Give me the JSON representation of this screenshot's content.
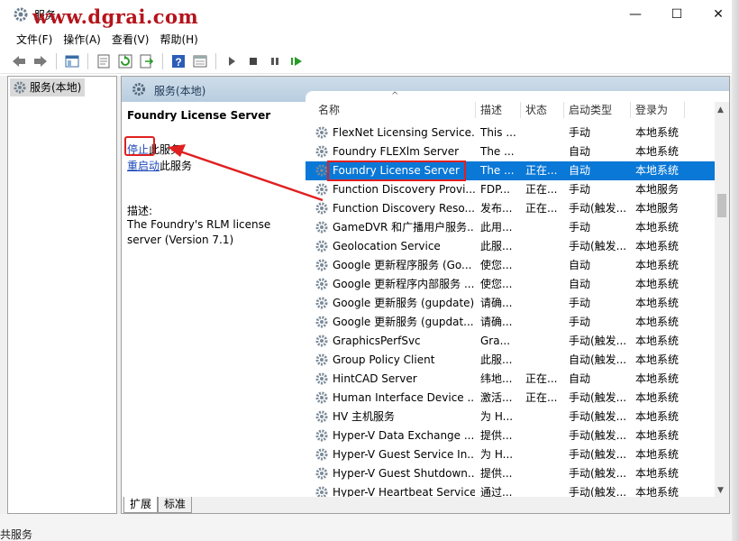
{
  "window": {
    "title": "服务",
    "watermark": "www.dgrai.com",
    "minimize_glyph": "—",
    "maximize_glyph": "☐",
    "close_glyph": "✕"
  },
  "menu": [
    "文件(F)",
    "操作(A)",
    "查看(V)",
    "帮助(H)"
  ],
  "tree": {
    "root": "服务(本地)"
  },
  "pane": {
    "header": "服务(本地)"
  },
  "detail": {
    "service_name": "Foundry License Server",
    "stop_link": "停止",
    "stop_suffix": "此服务",
    "restart_link": "重启动",
    "restart_suffix": "此服务",
    "desc_label": "描述:",
    "desc_text": "The Foundry's RLM license server (Version 7.1)"
  },
  "columns": [
    "名称",
    "描述",
    "状态",
    "启动类型",
    "登录为"
  ],
  "services": [
    {
      "name": "FlexNet Licensing Service...",
      "desc": "This ...",
      "status": "",
      "type": "手动",
      "logon": "本地系统"
    },
    {
      "name": "Foundry FLEXlm Server",
      "desc": "The ...",
      "status": "",
      "type": "自动",
      "logon": "本地系统"
    },
    {
      "name": "Foundry License Server",
      "desc": "The ...",
      "status": "正在...",
      "type": "自动",
      "logon": "本地系统"
    },
    {
      "name": "Function Discovery Provi...",
      "desc": "FDP...",
      "status": "正在...",
      "type": "手动",
      "logon": "本地服务"
    },
    {
      "name": "Function Discovery Reso...",
      "desc": "发布...",
      "status": "正在...",
      "type": "手动(触发...",
      "logon": "本地服务"
    },
    {
      "name": "GameDVR 和广播用户服务...",
      "desc": "此用...",
      "status": "",
      "type": "手动",
      "logon": "本地系统"
    },
    {
      "name": "Geolocation Service",
      "desc": "此服...",
      "status": "",
      "type": "手动(触发...",
      "logon": "本地系统"
    },
    {
      "name": "Google 更新程序服务 (Go...",
      "desc": "使您...",
      "status": "",
      "type": "自动",
      "logon": "本地系统"
    },
    {
      "name": "Google 更新程序内部服务 ...",
      "desc": "使您...",
      "status": "",
      "type": "自动",
      "logon": "本地系统"
    },
    {
      "name": "Google 更新服务 (gupdate)",
      "desc": "请确...",
      "status": "",
      "type": "手动",
      "logon": "本地系统"
    },
    {
      "name": "Google 更新服务 (gupdat...",
      "desc": "请确...",
      "status": "",
      "type": "手动",
      "logon": "本地系统"
    },
    {
      "name": "GraphicsPerfSvc",
      "desc": "Gra...",
      "status": "",
      "type": "手动(触发...",
      "logon": "本地系统"
    },
    {
      "name": "Group Policy Client",
      "desc": "此服...",
      "status": "",
      "type": "自动(触发...",
      "logon": "本地系统"
    },
    {
      "name": "HintCAD Server",
      "desc": "纬地...",
      "status": "正在...",
      "type": "自动",
      "logon": "本地系统"
    },
    {
      "name": "Human Interface Device ...",
      "desc": "激活...",
      "status": "正在...",
      "type": "手动(触发...",
      "logon": "本地系统"
    },
    {
      "name": "HV 主机服务",
      "desc": "为 H...",
      "status": "",
      "type": "手动(触发...",
      "logon": "本地系统"
    },
    {
      "name": "Hyper-V Data Exchange ...",
      "desc": "提供...",
      "status": "",
      "type": "手动(触发...",
      "logon": "本地系统"
    },
    {
      "name": "Hyper-V Guest Service In...",
      "desc": "为 H...",
      "status": "",
      "type": "手动(触发...",
      "logon": "本地系统"
    },
    {
      "name": "Hyper-V Guest Shutdown...",
      "desc": "提供...",
      "status": "",
      "type": "手动(触发...",
      "logon": "本地系统"
    },
    {
      "name": "Hyper-V Heartbeat Service",
      "desc": "通过...",
      "status": "",
      "type": "手动(触发...",
      "logon": "本地系统"
    }
  ],
  "selected_index": 2,
  "tabs": [
    "扩展",
    "标准"
  ],
  "background": {
    "partial_text": "共服务"
  },
  "colors": {
    "selection": "#0a78d7",
    "highlight_box": "#e02020",
    "link": "#1a47b8",
    "watermark": "#b5141c"
  }
}
